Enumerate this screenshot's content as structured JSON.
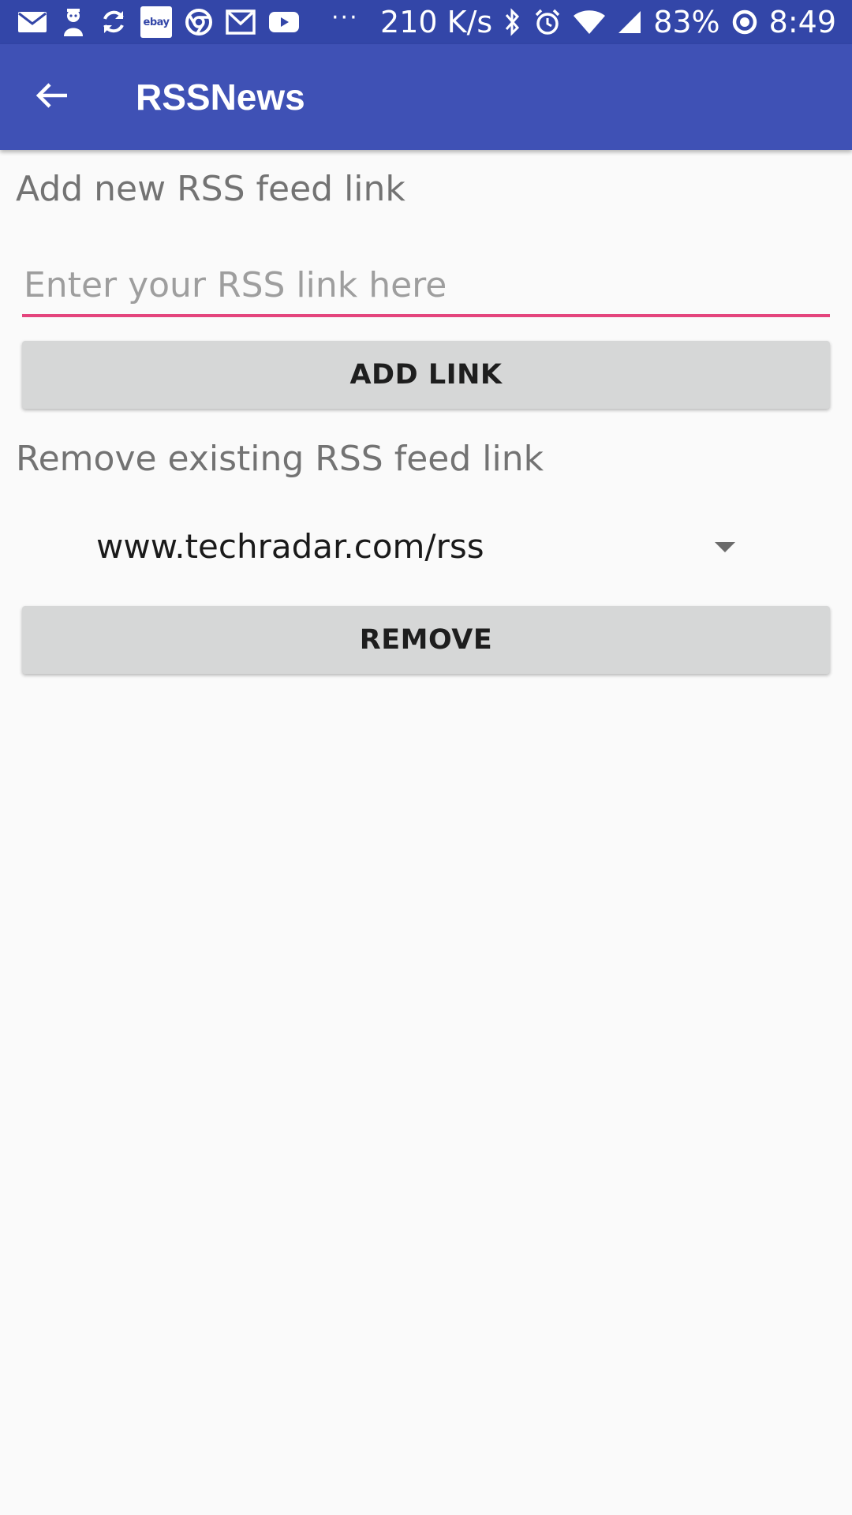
{
  "status_bar": {
    "notification_icons": [
      "mail-icon",
      "mascot-icon",
      "sync-icon",
      "ebay-icon",
      "chrome-icon",
      "gmail-icon",
      "youtube-icon"
    ],
    "ebay_label": "ebay",
    "overflow": "···",
    "net_speed": "210 K/s",
    "battery": "83%",
    "time": "8:49"
  },
  "app_bar": {
    "title": "RSSNews"
  },
  "add_section": {
    "label": "Add new RSS feed link",
    "input_placeholder": "Enter your RSS link here",
    "input_value": "",
    "button_label": "ADD LINK"
  },
  "remove_section": {
    "label": "Remove existing RSS feed link",
    "selected_feed": "www.techradar.com/rss",
    "button_label": "REMOVE"
  },
  "colors": {
    "status_bar": "#3346a8",
    "app_bar": "#3f51b5",
    "accent": "#e4457d",
    "background": "#fafafa",
    "button": "#d6d7d7"
  }
}
